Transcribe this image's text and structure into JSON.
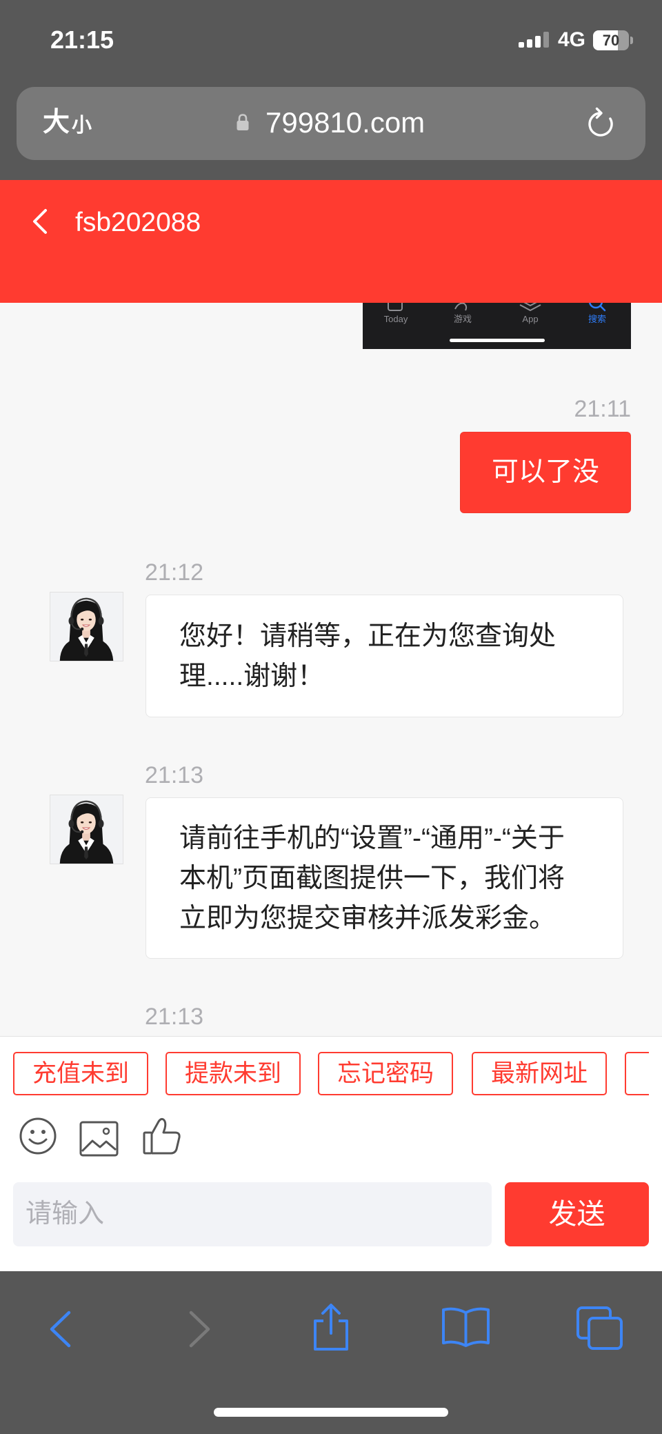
{
  "status_bar": {
    "time": "21:15",
    "network": "4G",
    "battery_percent": "70",
    "signal_bars": 3,
    "signal_icon": "cellular-signal-icon",
    "battery_icon": "battery-icon"
  },
  "address_bar": {
    "text_size_large": "大",
    "text_size_small": "小",
    "url": "799810.com",
    "lock_icon": "lock-icon",
    "reload_icon": "reload-icon"
  },
  "header": {
    "back_icon": "chevron-left-icon",
    "title": "fsb202088"
  },
  "chat": {
    "sent_image": {
      "tab_labels": [
        "Today",
        "游戏",
        "App",
        "搜索"
      ]
    },
    "messages": [
      {
        "time": "21:11",
        "lines": [
          "可以了没"
        ]
      },
      {
        "time": "21:12",
        "lines": [
          "您好！请稍等，正在为您查询处",
          "理.....谢谢！"
        ]
      },
      {
        "time": "21:13",
        "lines": [
          "请前往手机的“设置”-“通用”-“关于",
          "本机”页面截图提供一下，我们将",
          "立即为您提交审核并派发彩金。"
        ]
      },
      {
        "time": "21:13"
      }
    ]
  },
  "quick_replies": [
    "充值未到",
    "提款未到",
    "忘记密码",
    "最新网址"
  ],
  "tools": {
    "emoji_icon": "smiley-icon",
    "image_icon": "image-icon",
    "like_icon": "thumbs-up-icon"
  },
  "composer": {
    "placeholder": "请输入",
    "send_label": "发送"
  },
  "browser_toolbar": {
    "icons": [
      "chevron-left-icon",
      "chevron-right-icon",
      "share-icon",
      "bookmarks-icon",
      "tabs-icon"
    ]
  },
  "colors": {
    "accent": "#ff3b30",
    "chrome": "#585858",
    "address_bar": "#797979",
    "chat_bg": "#f7f7f7",
    "browser_bar": "#575757",
    "link_blue": "#3d85f5"
  }
}
